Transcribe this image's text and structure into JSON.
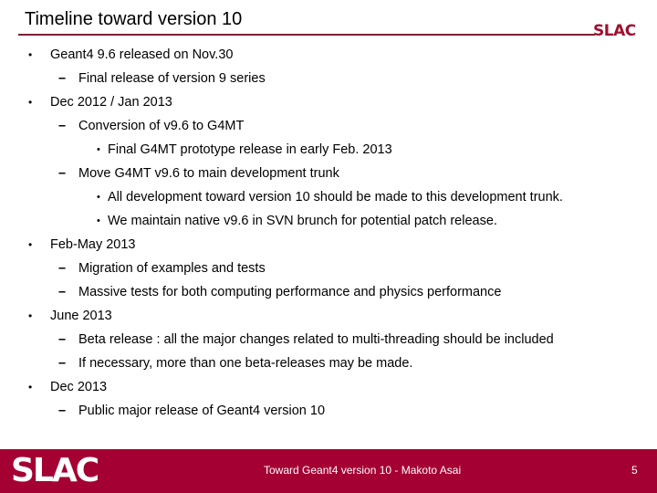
{
  "slide": {
    "title": "Timeline toward version 10",
    "logo_top": "SLAC",
    "accent_color": "#a50034",
    "rule_color": "#7a1f35"
  },
  "content": {
    "items": [
      {
        "level": 1,
        "bullet": "•",
        "text": "Geant4 9.6 released on Nov.30"
      },
      {
        "level": 2,
        "bullet": "–",
        "text": "Final release of version 9 series"
      },
      {
        "level": 1,
        "bullet": "•",
        "text": "Dec 2012 / Jan 2013"
      },
      {
        "level": 2,
        "bullet": "–",
        "text": "Conversion of v9.6 to G4MT"
      },
      {
        "level": 3,
        "bullet": "•",
        "text": "Final G4MT prototype release in early Feb. 2013"
      },
      {
        "level": 2,
        "bullet": "–",
        "text": "Move G4MT v9.6 to main development trunk"
      },
      {
        "level": 3,
        "bullet": "•",
        "text": "All development toward version 10 should be made to this development trunk."
      },
      {
        "level": 3,
        "bullet": "•",
        "text": "We maintain native v9.6 in SVN brunch for potential patch release."
      },
      {
        "level": 1,
        "bullet": "•",
        "text": "Feb-May 2013"
      },
      {
        "level": 2,
        "bullet": "–",
        "text": "Migration of examples and tests"
      },
      {
        "level": 2,
        "bullet": "–",
        "text": "Massive tests for both computing performance and physics performance"
      },
      {
        "level": 1,
        "bullet": "•",
        "text": "June 2013"
      },
      {
        "level": 2,
        "bullet": "–",
        "text": "Beta release : all the major changes related to multi-threading should be included"
      },
      {
        "level": 2,
        "bullet": "–",
        "text": "If necessary, more than one beta-releases may be made."
      },
      {
        "level": 1,
        "bullet": "•",
        "text": "Dec 2013"
      },
      {
        "level": 2,
        "bullet": "–",
        "text": "Public major release of Geant4 version 10"
      }
    ]
  },
  "footer": {
    "logo": "SLAC",
    "text": "Toward Geant4 version 10 - Makoto Asai",
    "page_number": "5"
  }
}
